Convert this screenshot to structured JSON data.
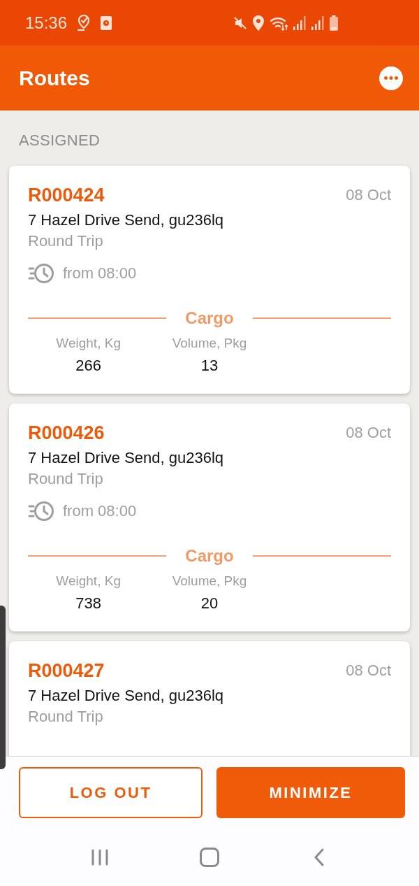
{
  "status_bar": {
    "time": "15:36"
  },
  "app_bar": {
    "title": "Routes"
  },
  "section": {
    "title": "ASSIGNED"
  },
  "routes": [
    {
      "id": "R000424",
      "date": "08 Oct",
      "address": "7 Hazel Drive Send, gu236lq",
      "trip_type": "Round Trip",
      "time": "from 08:00",
      "cargo": {
        "title": "Cargo",
        "metrics": [
          {
            "label": "Weight, Kg",
            "value": "266"
          },
          {
            "label": "Volume, Pkg",
            "value": "13"
          }
        ]
      }
    },
    {
      "id": "R000426",
      "date": "08 Oct",
      "address": "7 Hazel Drive Send, gu236lq",
      "trip_type": "Round Trip",
      "time": "from 08:00",
      "cargo": {
        "title": "Cargo",
        "metrics": [
          {
            "label": "Weight, Kg",
            "value": "738"
          },
          {
            "label": "Volume, Pkg",
            "value": "20"
          }
        ]
      }
    },
    {
      "id": "R000427",
      "date": "08 Oct",
      "address": "7 Hazel Drive Send, gu236lq",
      "trip_type": "Round Trip"
    }
  ],
  "buttons": [
    {
      "label": "LOG OUT",
      "kind": "outline"
    },
    {
      "label": "MINIMIZE",
      "kind": "filled"
    }
  ]
}
